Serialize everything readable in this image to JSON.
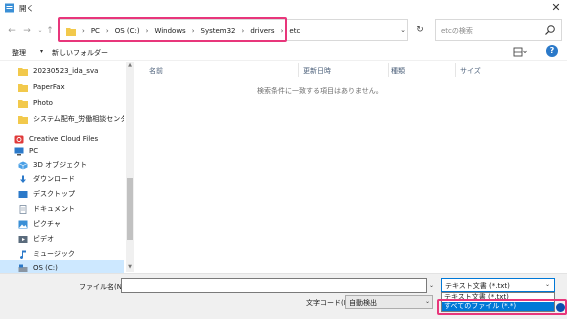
{
  "window": {
    "title": "開く",
    "close_glyph": "✕"
  },
  "address": {
    "crumbs": [
      "PC",
      "OS (C:)",
      "Windows",
      "System32",
      "drivers",
      "etc"
    ],
    "search_placeholder": "etcの検索"
  },
  "toolbar": {
    "organize": "整理",
    "new_folder": "新しいフォルダー"
  },
  "sidebar": {
    "items": [
      {
        "label": "20230523_ida_sva",
        "icon": "folder-icon",
        "color": "#f2c94c"
      },
      {
        "label": "PaperFax",
        "icon": "folder-icon",
        "color": "#f2c94c"
      },
      {
        "label": "Photo",
        "icon": "folder-icon",
        "color": "#f2c94c"
      },
      {
        "label": "システム配布_労働相談センター",
        "icon": "folder-icon",
        "color": "#f2c94c"
      },
      {
        "label": "Creative Cloud Files",
        "icon": "creative-cloud-icon",
        "color": "#e03a3a"
      },
      {
        "label": "PC",
        "icon": "pc-icon",
        "color": "#2b79c9"
      },
      {
        "label": "3D オブジェクト",
        "icon": "3d-objects-icon",
        "color": "#4aa0e6"
      },
      {
        "label": "ダウンロード",
        "icon": "download-icon",
        "color": "#2b79c9"
      },
      {
        "label": "デスクトップ",
        "icon": "desktop-icon",
        "color": "#2b79c9"
      },
      {
        "label": "ドキュメント",
        "icon": "documents-icon",
        "color": "#7a8ca0"
      },
      {
        "label": "ピクチャ",
        "icon": "pictures-icon",
        "color": "#3a8fd6"
      },
      {
        "label": "ビデオ",
        "icon": "videos-icon",
        "color": "#5a6b7c"
      },
      {
        "label": "ミュージック",
        "icon": "music-icon",
        "color": "#2b79c9"
      },
      {
        "label": "OS (C:)",
        "icon": "drive-icon",
        "color": "#8a96a3",
        "selected": true
      }
    ]
  },
  "content": {
    "columns": [
      "名前",
      "更新日時",
      "種類",
      "サイズ"
    ],
    "empty_message": "検索条件に一致する項目はありません。"
  },
  "bottom": {
    "filename_label": "ファイル名(N):",
    "filename_value": "",
    "filter_selected": "テキスト文書 (*.txt)",
    "filter_options": [
      "テキスト文書 (*.txt)",
      "すべてのファイル (*.*)"
    ],
    "encoding_label": "文字コード(E):",
    "encoding_value": "自動検出"
  },
  "colors": {
    "highlight": "#e8367b",
    "selection": "#0078d7"
  }
}
